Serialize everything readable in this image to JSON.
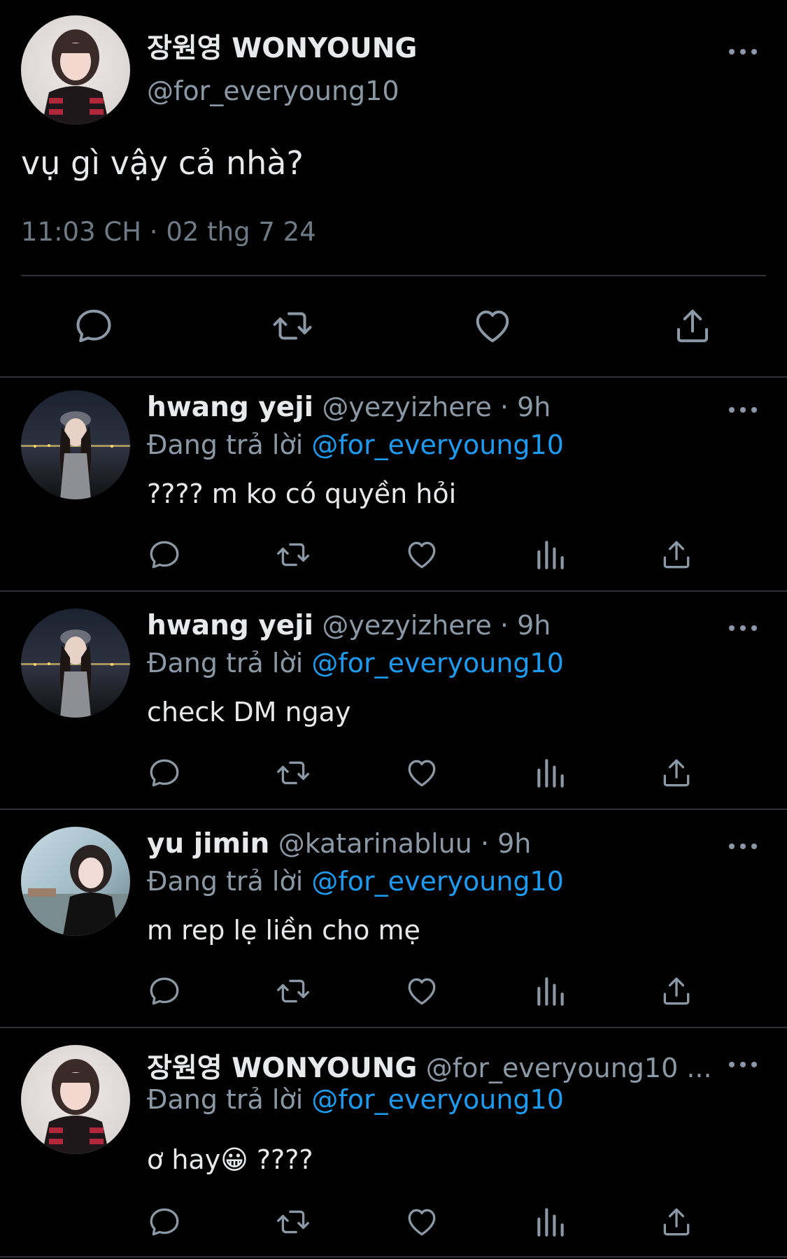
{
  "main_tweet": {
    "display_name": "장원영 WONYOUNG",
    "handle": "@for_everyoung10",
    "text": "vụ gì vậy cả nhà?",
    "timestamp": "11:03 CH · 02 thg 7 24"
  },
  "reply_prefix": "Đang trả lời",
  "replies": [
    {
      "display_name": "hwang yeji",
      "meta": "@yezyizhere · 9h",
      "reply_to": "@for_everyoung10",
      "text": "???? m ko có quyền hỏi"
    },
    {
      "display_name": "hwang yeji",
      "meta": "@yezyizhere · 9h",
      "reply_to": "@for_everyoung10",
      "text": "check DM ngay"
    },
    {
      "display_name": "yu jimin",
      "meta": "@katarinabluu · 9h",
      "reply_to": "@for_everyoung10",
      "text": "m rep lẹ liền cho mẹ"
    },
    {
      "display_name": "장원영 WONYOUNG",
      "meta": "@for_everyoung10 ...",
      "reply_to": "@for_everyoung10",
      "text_before_emoji": "ơ hay",
      "text_emoji": "😀",
      "text_after_emoji": " ????"
    }
  ],
  "icons": [
    "reply-icon",
    "retweet-icon",
    "like-icon",
    "views-icon",
    "share-icon",
    "more-icon"
  ],
  "colors": {
    "background": "#000000",
    "text": "#e7e9ea",
    "secondary": "#8b98a5",
    "link": "#1d9bf0",
    "divider": "#2f3336"
  }
}
